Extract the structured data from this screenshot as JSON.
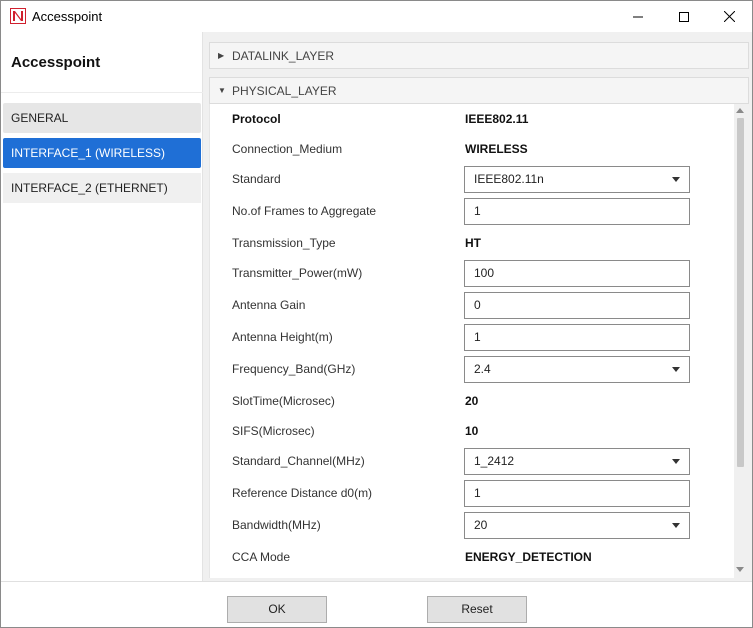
{
  "window": {
    "title": "Accesspoint",
    "brand_color": "#d0202e"
  },
  "left_panel": {
    "title": "Accesspoint",
    "items": [
      {
        "label": "GENERAL"
      },
      {
        "label": "INTERFACE_1 (WIRELESS)",
        "selected": true
      },
      {
        "label": "INTERFACE_2 (ETHERNET)"
      }
    ],
    "selected_color": "#1f6fd6"
  },
  "sections": {
    "datalink": {
      "label": "DATALINK_LAYER",
      "expanded": false
    },
    "physical": {
      "label": "PHYSICAL_LAYER",
      "expanded": true
    }
  },
  "physical_rows": [
    {
      "label": "Protocol",
      "type": "text",
      "value": "IEEE802.11"
    },
    {
      "label": "Connection_Medium",
      "type": "text",
      "value": "WIRELESS"
    },
    {
      "label": "Standard",
      "type": "select",
      "value": "IEEE802.11n"
    },
    {
      "label": "No.of Frames to Aggregate",
      "type": "input",
      "value": "1"
    },
    {
      "label": "Transmission_Type",
      "type": "text",
      "value": "HT"
    },
    {
      "label": "Transmitter_Power(mW)",
      "type": "input",
      "value": "100"
    },
    {
      "label": "Antenna Gain",
      "type": "input",
      "value": "0"
    },
    {
      "label": "Antenna Height(m)",
      "type": "input",
      "value": "1"
    },
    {
      "label": "Frequency_Band(GHz)",
      "type": "select",
      "value": "2.4"
    },
    {
      "label": "SlotTime(Microsec)",
      "type": "text",
      "value": "20"
    },
    {
      "label": "SIFS(Microsec)",
      "type": "text",
      "value": "10"
    },
    {
      "label": "Standard_Channel(MHz)",
      "type": "select",
      "value": "1_2412"
    },
    {
      "label": "Reference Distance d0(m)",
      "type": "input",
      "value": "1"
    },
    {
      "label": "Bandwidth(MHz)",
      "type": "select",
      "value": "20"
    },
    {
      "label": "CCA Mode",
      "type": "text",
      "value": "ENERGY_DETECTION"
    }
  ],
  "footer": {
    "ok_label": "OK",
    "reset_label": "Reset"
  }
}
